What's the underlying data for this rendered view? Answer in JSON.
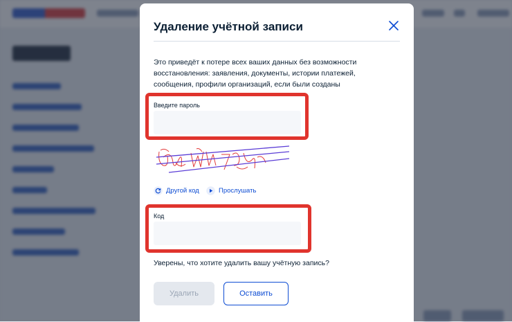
{
  "modal": {
    "title": "Удаление учётной записи",
    "warning": "Это приведёт к потере всех ваших данных без возможности восстановления: заявления, документы, истории платежей, сообщения, профили организаций, если были созданы",
    "password_label": "Введите пароль",
    "password_value": "",
    "captcha_text": "ЧП УЙ7 Ч6",
    "refresh_label": "Другой код",
    "listen_label": "Прослушать",
    "code_label": "Код",
    "code_value": "",
    "confirm_text": "Уверены, что хотите удалить вашу учётную запись?",
    "delete_label": "Удалить",
    "keep_label": "Оставить"
  },
  "icons": {
    "close": "close-icon",
    "refresh": "refresh-icon",
    "play": "play-icon"
  },
  "colors": {
    "accent": "#0d4cd3",
    "highlight": "#e0342d",
    "text": "#0b1f33",
    "disabled_bg": "#e4e8ee"
  }
}
